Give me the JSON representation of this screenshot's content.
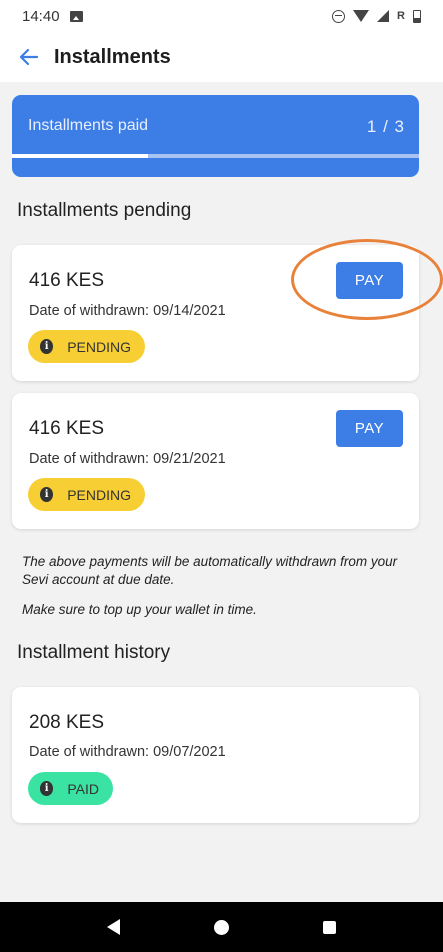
{
  "status_bar": {
    "time": "14:40",
    "network_label": "R",
    "icons": [
      "image-icon",
      "do-not-disturb-icon",
      "wifi-icon",
      "signal-icon",
      "battery-icon"
    ]
  },
  "header": {
    "back_icon": "arrow-left-icon",
    "title": "Installments"
  },
  "progress": {
    "label": "Installments paid",
    "count": "1 / 3",
    "paid": 1,
    "total": 3
  },
  "pending_section": {
    "title": "Installments pending",
    "items": [
      {
        "amount": "416 KES",
        "date_line": "Date of withdrawn: 09/14/2021",
        "status": "PENDING",
        "pay_label": "PAY"
      },
      {
        "amount": "416 KES",
        "date_line": "Date of withdrawn: 09/21/2021",
        "status": "PENDING",
        "pay_label": "PAY"
      }
    ],
    "note_1": "The above payments will be automatically withdrawn from your Sevi account at due date.",
    "note_2": "Make sure to top up your wallet in time."
  },
  "history_section": {
    "title": "Installment history",
    "items": [
      {
        "amount": "208 KES",
        "date_line": "Date of withdrawn: 09/07/2021",
        "status": "PAID"
      }
    ]
  },
  "colors": {
    "primary": "#3d7de6",
    "pending_badge": "#f7cf35",
    "paid_badge": "#3be3a2",
    "highlight": "#e8823a",
    "background": "#f2f2f2"
  },
  "nav_bar": {
    "icons": [
      "nav-back-icon",
      "nav-home-icon",
      "nav-recents-icon"
    ]
  }
}
